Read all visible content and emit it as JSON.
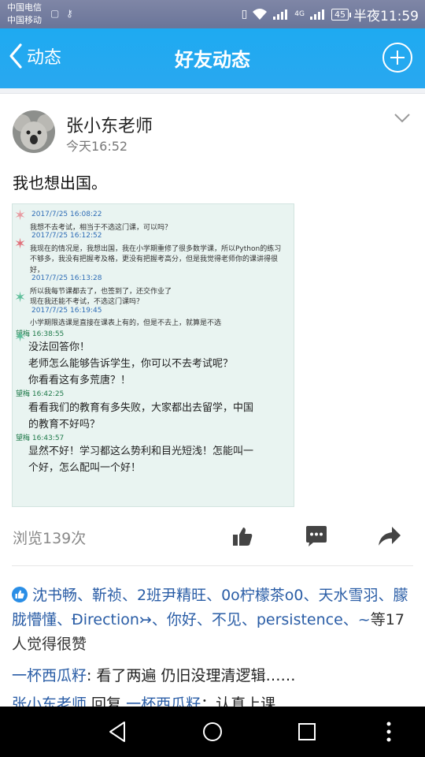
{
  "status_bar": {
    "carrier_1": "中国电信",
    "carrier_2": "中国移动",
    "network_label": "4G",
    "battery": "45",
    "time": "半夜11:59"
  },
  "header": {
    "back_label": "动态",
    "title": "好友动态"
  },
  "post": {
    "author": "张小东老师",
    "time": "今天16:52",
    "text": "我也想出国。",
    "image_lines": [
      {
        "text": "2017/7/25 16:08:22",
        "cls": "ts"
      },
      {
        "text": "我想不去考试，相当于不选这门课，可以吗？",
        "cls": "s"
      },
      {
        "text": "2017/7/25 16:12:52",
        "cls": "ts"
      },
      {
        "text": "我现在的情况是，我想出国，我在小学期重修了很多数学课，所以Python的练习",
        "cls": "s"
      },
      {
        "text": "不够多，我没有把握考及格，更没有把握考高分，但是我觉得老师你的课讲得很",
        "cls": "s"
      },
      {
        "text": "好，",
        "cls": "s"
      },
      {
        "text": "2017/7/25 16:13:28",
        "cls": "ts"
      },
      {
        "text": "所以我每节课都去了，也签到了，还交作业了",
        "cls": "s"
      },
      {
        "text": "现在我还能不考试，不选这门课吗？",
        "cls": "s"
      },
      {
        "text": "2017/7/25 16:19:45",
        "cls": "ts"
      },
      {
        "text": "小学期限选课是直接在课表上有的，但是不去上，就算是不选",
        "cls": "s"
      },
      {
        "text": "望梅  16:38:55",
        "cls": "ts2"
      },
      {
        "text": "没法回答你！",
        "cls": "b"
      },
      {
        "text": "老师怎么能够告诉学生，你可以不去考试呢？",
        "cls": "b"
      },
      {
        "text": "你看看这有多荒唐？！",
        "cls": "b"
      },
      {
        "text": "望梅  16:42:25",
        "cls": "ts2"
      },
      {
        "text": "看看我们的教育有多失败，大家都出去留学，中国",
        "cls": "b"
      },
      {
        "text": "的教育不好吗？",
        "cls": "b"
      },
      {
        "text": "望梅  16:43:57",
        "cls": "ts2"
      },
      {
        "text": "显然不好！学习都这么势利和目光短浅！怎能叫一",
        "cls": "b"
      },
      {
        "text": "个好，怎么配叫一个好！",
        "cls": "b"
      }
    ],
    "views": "浏览139次"
  },
  "likes": {
    "names": "沈书畅、靳祯、2班尹精旺、0o柠檬茶o0、天水雪羽、朦胧懵懂、Ðirection↣、你好、不见、persistence、~",
    "suffix": "等17人觉得很赞"
  },
  "comments": [
    {
      "name": "一杯西瓜籽",
      "text": ": 看了两遍 仍旧没理清逻辑……"
    },
    {
      "name": "张小东老师",
      "reply": " 回复 ",
      "target": "一杯西瓜籽",
      "text": "：认真上课"
    }
  ],
  "colors": {
    "header_blue": "#29a8f0",
    "link_blue": "#2a5da6",
    "status_bar": "#6f7a9c"
  },
  "icons": [
    "back-chevron-icon",
    "add-circle-icon",
    "chevron-down-icon",
    "thumbs-up-icon",
    "comment-icon",
    "share-icon",
    "like-badge-icon",
    "nav-back-icon",
    "nav-home-icon",
    "nav-recents-icon",
    "nav-menu-icon"
  ]
}
